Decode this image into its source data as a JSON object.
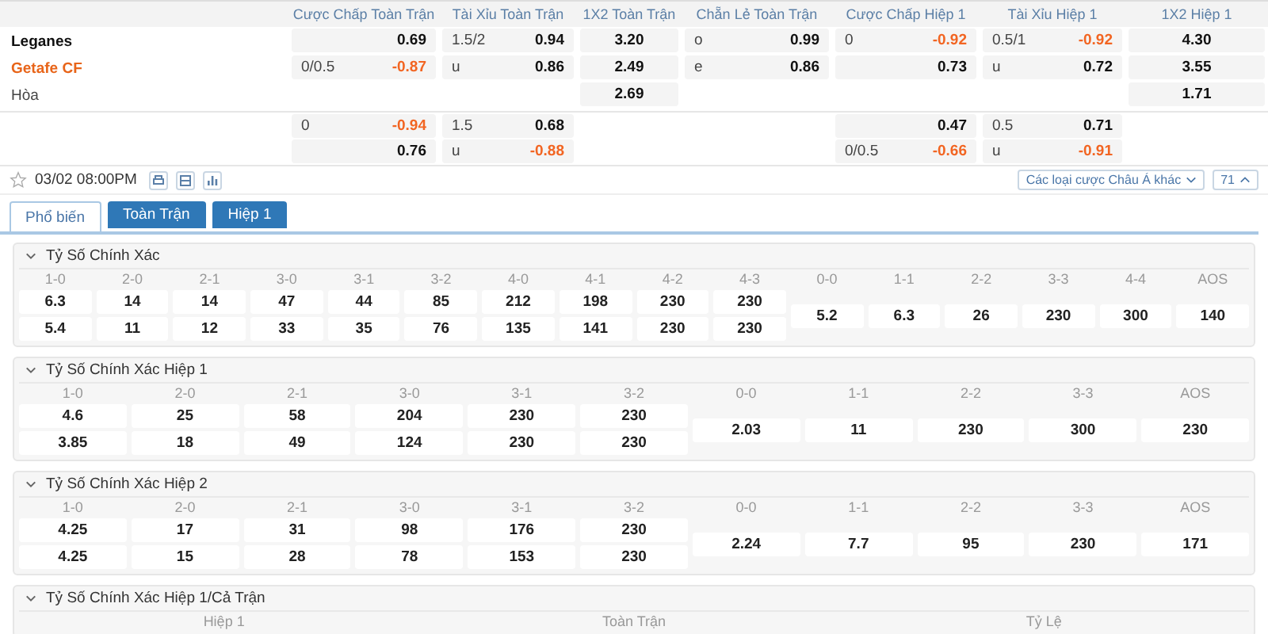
{
  "market": {
    "columns": [
      {
        "title": "Cược Chấp Toàn Trận",
        "kind": "pair"
      },
      {
        "title": "Tài Xỉu Toàn Trận",
        "kind": "pair"
      },
      {
        "title": "1X2 Toàn Trận",
        "kind": "single"
      },
      {
        "title": "Chẵn Lẻ Toàn Trận",
        "kind": "pair"
      },
      {
        "title": "Cược Chấp Hiệp 1",
        "kind": "pair"
      },
      {
        "title": "Tài Xỉu Hiệp 1",
        "kind": "pair"
      },
      {
        "title": "1X2 Hiệp 1",
        "kind": "single"
      }
    ],
    "groups": [
      [
        {
          "team": "Leganes",
          "kind": "home",
          "cells": [
            {
              "odds": "0.69",
              "negative": false
            },
            {
              "line": "1.5/2",
              "odds": "0.94",
              "negative": false
            },
            {
              "odds": "3.20",
              "negative": false
            },
            {
              "line": "o",
              "odds": "0.99",
              "negative": false
            },
            {
              "line": "0",
              "odds": "-0.92",
              "negative": true
            },
            {
              "line": "0.5/1",
              "odds": "-0.92",
              "negative": true
            },
            {
              "odds": "4.30",
              "negative": false
            }
          ]
        },
        {
          "team": "Getafe CF",
          "kind": "away",
          "cells": [
            {
              "line": "0/0.5",
              "odds": "-0.87",
              "negative": true
            },
            {
              "line": "u",
              "odds": "0.86",
              "negative": false
            },
            {
              "odds": "2.49",
              "negative": false
            },
            {
              "line": "e",
              "odds": "0.86",
              "negative": false
            },
            {
              "odds": "0.73",
              "negative": false
            },
            {
              "line": "u",
              "odds": "0.72",
              "negative": false
            },
            {
              "odds": "3.55",
              "negative": false
            }
          ]
        },
        {
          "team": "Hòa",
          "kind": "draw",
          "cells": [
            null,
            null,
            {
              "odds": "2.69",
              "negative": false
            },
            null,
            null,
            null,
            {
              "odds": "1.71",
              "negative": false
            }
          ]
        }
      ],
      [
        {
          "cells": [
            {
              "line": "0",
              "odds": "-0.94",
              "negative": true
            },
            {
              "line": "1.5",
              "odds": "0.68",
              "negative": false
            },
            null,
            null,
            {
              "odds": "0.47",
              "negative": false
            },
            {
              "line": "0.5",
              "odds": "0.71",
              "negative": false
            },
            null
          ]
        },
        {
          "cells": [
            {
              "odds": "0.76",
              "negative": false
            },
            {
              "line": "u",
              "odds": "-0.88",
              "negative": true
            },
            null,
            null,
            {
              "line": "0/0.5",
              "odds": "-0.66",
              "negative": true
            },
            {
              "line": "u",
              "odds": "-0.91",
              "negative": true
            },
            null
          ]
        }
      ]
    ]
  },
  "toolbar": {
    "datetime": "03/02 08:00PM",
    "favorite": false,
    "bet_type_select": "Các loại cược Châu Á khác",
    "count": "71"
  },
  "tabs": [
    {
      "label": "Phổ biến",
      "selected": true
    },
    {
      "label": "Toàn Trận",
      "selected": false
    },
    {
      "label": "Hiệp 1",
      "selected": false
    }
  ],
  "sections": [
    {
      "title": "Tỷ Số Chính Xác",
      "expanded": true,
      "columns": [
        {
          "score": "1-0",
          "values": [
            "6.3",
            "5.4"
          ]
        },
        {
          "score": "2-0",
          "values": [
            "14",
            "11"
          ]
        },
        {
          "score": "2-1",
          "values": [
            "14",
            "12"
          ]
        },
        {
          "score": "3-0",
          "values": [
            "47",
            "33"
          ]
        },
        {
          "score": "3-1",
          "values": [
            "44",
            "35"
          ]
        },
        {
          "score": "3-2",
          "values": [
            "85",
            "76"
          ]
        },
        {
          "score": "4-0",
          "values": [
            "212",
            "135"
          ]
        },
        {
          "score": "4-1",
          "values": [
            "198",
            "141"
          ]
        },
        {
          "score": "4-2",
          "values": [
            "230",
            "230"
          ]
        },
        {
          "score": "4-3",
          "values": [
            "230",
            "230"
          ]
        },
        {
          "score": "0-0",
          "values": [
            "5.2"
          ]
        },
        {
          "score": "1-1",
          "values": [
            "6.3"
          ]
        },
        {
          "score": "2-2",
          "values": [
            "26"
          ]
        },
        {
          "score": "3-3",
          "values": [
            "230"
          ]
        },
        {
          "score": "4-4",
          "values": [
            "300"
          ]
        },
        {
          "score": "AOS",
          "values": [
            "140"
          ]
        }
      ]
    },
    {
      "title": "Tỷ Số Chính Xác Hiệp 1",
      "expanded": true,
      "columns": [
        {
          "score": "1-0",
          "values": [
            "4.6",
            "3.85"
          ]
        },
        {
          "score": "2-0",
          "values": [
            "25",
            "18"
          ]
        },
        {
          "score": "2-1",
          "values": [
            "58",
            "49"
          ]
        },
        {
          "score": "3-0",
          "values": [
            "204",
            "124"
          ]
        },
        {
          "score": "3-1",
          "values": [
            "230",
            "230"
          ]
        },
        {
          "score": "3-2",
          "values": [
            "230",
            "230"
          ]
        },
        {
          "score": "0-0",
          "values": [
            "2.03"
          ]
        },
        {
          "score": "1-1",
          "values": [
            "11"
          ]
        },
        {
          "score": "2-2",
          "values": [
            "230"
          ]
        },
        {
          "score": "3-3",
          "values": [
            "300"
          ]
        },
        {
          "score": "AOS",
          "values": [
            "230"
          ]
        }
      ]
    },
    {
      "title": "Tỷ Số Chính Xác Hiệp 2",
      "expanded": true,
      "columns": [
        {
          "score": "1-0",
          "values": [
            "4.25",
            "4.25"
          ]
        },
        {
          "score": "2-0",
          "values": [
            "17",
            "15"
          ]
        },
        {
          "score": "2-1",
          "values": [
            "31",
            "28"
          ]
        },
        {
          "score": "3-0",
          "values": [
            "98",
            "78"
          ]
        },
        {
          "score": "3-1",
          "values": [
            "176",
            "153"
          ]
        },
        {
          "score": "3-2",
          "values": [
            "230",
            "230"
          ]
        },
        {
          "score": "0-0",
          "values": [
            "2.24"
          ]
        },
        {
          "score": "1-1",
          "values": [
            "7.7"
          ]
        },
        {
          "score": "2-2",
          "values": [
            "95"
          ]
        },
        {
          "score": "3-3",
          "values": [
            "230"
          ]
        },
        {
          "score": "AOS",
          "values": [
            "171"
          ]
        }
      ]
    },
    {
      "title": "Tỷ Số Chính Xác Hiệp 1/Cả Trận",
      "expanded": true,
      "headers": [
        "Hiệp 1",
        "Toàn Trận",
        "Tỷ Lệ"
      ]
    }
  ]
}
